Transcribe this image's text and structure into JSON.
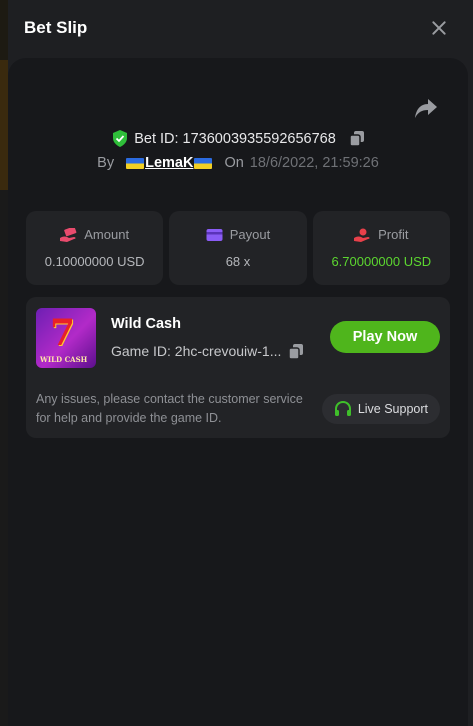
{
  "modal": {
    "title": "Bet Slip"
  },
  "bet": {
    "bet_id_label": "Bet ID: 1736003935592656768",
    "by_label": "By",
    "username": "LemaK",
    "on_label": "On",
    "date": "18/6/2022, 21:59:26"
  },
  "stats": [
    {
      "label": "Amount",
      "value": "0.10000000 USD",
      "icon": "money-hand-icon",
      "icon_color": "#e94b6d"
    },
    {
      "label": "Payout",
      "value": "68 x",
      "icon": "card-icon",
      "icon_color": "#8a5cf5"
    },
    {
      "label": "Profit",
      "value": "6.70000000 USD",
      "icon": "profit-hand-icon",
      "icon_color": "#e8404a",
      "value_color": "#5cd630"
    }
  ],
  "game": {
    "name": "Wild Cash",
    "game_id": "Game ID: 2hc-crevouiw-1...",
    "thumb_text": "WILD CASH",
    "play_label": "Play Now",
    "help_text": "Any issues, please contact the customer service for help and provide the game ID.",
    "support_label": "Live Support"
  },
  "colors": {
    "accent_green": "#4fb51c",
    "profit_green": "#5cd630",
    "verified_green": "#2fbf3a"
  }
}
